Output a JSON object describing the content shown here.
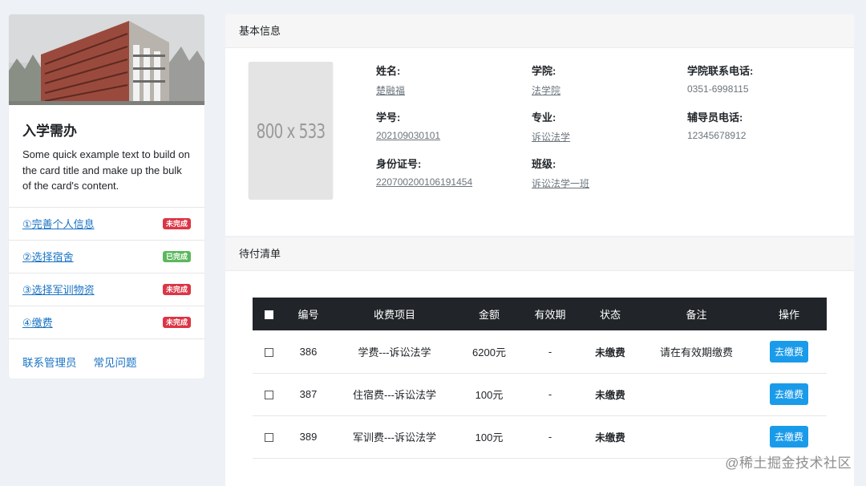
{
  "left_card": {
    "title": "入学需办",
    "text": "Some quick example text to build on the card title and make up the bulk of the card's content.",
    "todos": [
      {
        "label": "①完善个人信息",
        "status": "未完成",
        "done": false
      },
      {
        "label": "②选择宿舍",
        "status": "已完成",
        "done": true
      },
      {
        "label": "③选择军训物资",
        "status": "未完成",
        "done": false
      },
      {
        "label": "④缴费",
        "status": "未完成",
        "done": false
      }
    ],
    "links": {
      "admin": "联系管理员",
      "faq": "常见问题"
    }
  },
  "basic_info": {
    "header": "基本信息",
    "placeholder_text": "800 x 533",
    "fields": {
      "name": {
        "label": "姓名:",
        "value": "楚融福"
      },
      "college": {
        "label": "学院:",
        "value": "法学院"
      },
      "college_phone": {
        "label": "学院联系电话:",
        "value": "0351-6998115"
      },
      "student_id": {
        "label": "学号:",
        "value": "202109030101"
      },
      "major": {
        "label": "专业:",
        "value": "诉讼法学"
      },
      "counselor_phone": {
        "label": "辅导员电话:",
        "value": "12345678912"
      },
      "id_card": {
        "label": "身份证号:",
        "value": "220700200106191454"
      },
      "class": {
        "label": "班级:",
        "value": "诉讼法学一班"
      }
    }
  },
  "payment": {
    "header": "待付清单",
    "columns": [
      "编号",
      "收费项目",
      "金额",
      "有效期",
      "状态",
      "备注",
      "操作"
    ],
    "rows": [
      {
        "id": "386",
        "item": "学费---诉讼法学",
        "amount": "6200元",
        "valid": "-",
        "status": "未缴费",
        "note": "请在有效期缴费",
        "action": "去缴费"
      },
      {
        "id": "387",
        "item": "住宿费---诉讼法学",
        "amount": "100元",
        "valid": "-",
        "status": "未缴费",
        "note": "",
        "action": "去缴费"
      },
      {
        "id": "389",
        "item": "军训费---诉讼法学",
        "amount": "100元",
        "valid": "-",
        "status": "未缴费",
        "note": "",
        "action": "去缴费"
      }
    ]
  },
  "watermark": "@稀土掘金技术社区",
  "colors": {
    "link": "#1a73c4",
    "danger": "#dc3545",
    "success": "#5cb85c",
    "table_head": "#212529",
    "button": "#1a9bea"
  }
}
